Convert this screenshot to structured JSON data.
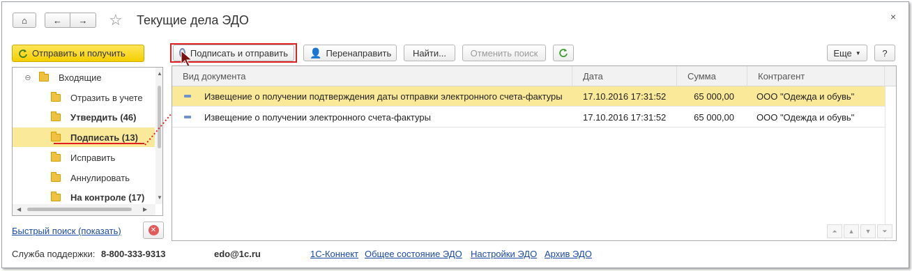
{
  "window": {
    "title": "Текущие дела ЭДО",
    "close_label": "×"
  },
  "nav": {
    "home_label": "⌂",
    "back_label": "←",
    "forward_label": "→",
    "favorite_label": "☆"
  },
  "sidebar": {
    "send_receive_label": "Отправить и получить",
    "tree": [
      {
        "label": "Входящие",
        "bold": false,
        "selected": false,
        "root": true
      },
      {
        "label": "Отразить в учете",
        "bold": false,
        "selected": false
      },
      {
        "label": "Утвердить (46)",
        "bold": true,
        "selected": false
      },
      {
        "label": "Подписать (13)",
        "bold": true,
        "selected": true
      },
      {
        "label": "Исправить",
        "bold": false,
        "selected": false
      },
      {
        "label": "Аннулировать",
        "bold": false,
        "selected": false
      },
      {
        "label": "На контроле (17)",
        "bold": true,
        "selected": false
      }
    ],
    "quick_search_label": "Быстрый поиск (показать)"
  },
  "toolbar": {
    "sign_send_label": "Подписать и отправить",
    "redirect_label": "Перенаправить",
    "find_label": "Найти...",
    "cancel_search_label": "Отменить поиск",
    "more_label": "Еще",
    "help_label": "?"
  },
  "table": {
    "columns": [
      "Вид документа",
      "Дата",
      "Сумма",
      "Контрагент"
    ],
    "rows": [
      {
        "doc_type": "Извещение о получении подтверждения даты отправки электронного счета-фактуры",
        "date": "17.10.2016 17:31:52",
        "sum": "65 000,00",
        "counterparty": "ООО \"Одежда и обувь\""
      },
      {
        "doc_type": "Извещение о получении электронного счета-фактуры",
        "date": "17.10.2016 17:31:52",
        "sum": "65 000,00",
        "counterparty": "ООО \"Одежда и обувь\""
      }
    ]
  },
  "footer": {
    "support_label": "Служба поддержки:",
    "support_phone": "8-800-333-9313",
    "support_email": "edo@1c.ru",
    "links": [
      "1С-Коннект",
      "Общее состояние ЭДО",
      "Настройки ЭДО",
      "Архив ЭДО"
    ]
  },
  "colors": {
    "accent_yellow": "#f4cf00",
    "selection": "#fbe99a",
    "link": "#1a4aa6",
    "annotation_red": "#e02020"
  }
}
